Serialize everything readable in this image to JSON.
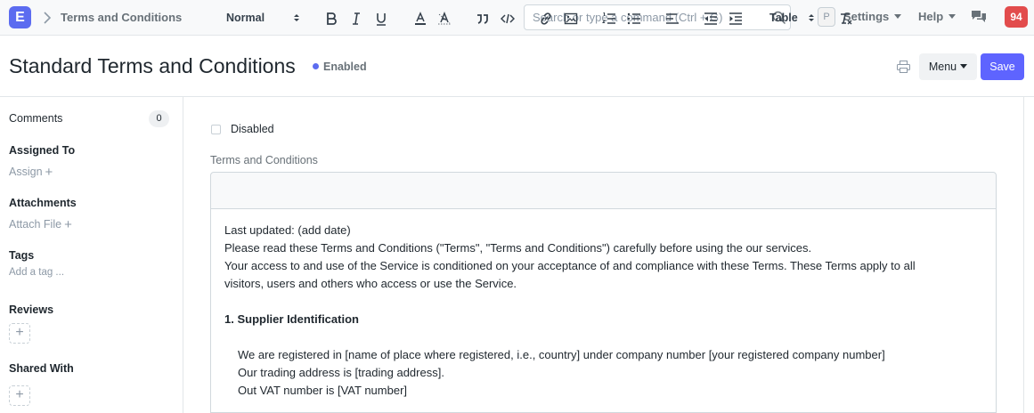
{
  "navbar": {
    "logo_letter": "E",
    "breadcrumb": "Terms and Conditions",
    "search_placeholder": "Search or type a command (Ctrl + G)",
    "user_badge": "P",
    "settings_label": "Settings",
    "help_label": "Help",
    "notification_count": "94"
  },
  "page": {
    "title": "Standard Terms and Conditions",
    "status": "Enabled",
    "menu_label": "Menu",
    "save_label": "Save"
  },
  "sidebar": {
    "comments_label": "Comments",
    "comments_count": "0",
    "assigned_to_label": "Assigned To",
    "assign_link": "Assign",
    "attachments_label": "Attachments",
    "attach_link": "Attach File",
    "tags_label": "Tags",
    "add_tag_link": "Add a tag ...",
    "reviews_label": "Reviews",
    "shared_with_label": "Shared With"
  },
  "form": {
    "disabled_label": "Disabled",
    "terms_label": "Terms and Conditions",
    "toolbar": {
      "format_select": "Normal",
      "table_select": "Table"
    },
    "editor_lines": [
      "Last updated: (add date)",
      "Please read these Terms and Conditions (\"Terms\", \"Terms and Conditions\") carefully before using the our services.",
      "Your access to and use of the Service is conditioned on your acceptance of and compliance with these Terms. These Terms apply to all",
      "visitors, users and others who access or use the Service.",
      "1. Supplier Identification",
      "We are registered in [name of place where registered, i.e., country] under company number [your registered company number]",
      "Our trading address is [trading address].",
      "Out VAT number is [VAT number]"
    ]
  },
  "colors": {
    "accent": "#5e64ff",
    "notification": "#e24c4c",
    "status_dot": "#5c6cf0"
  },
  "icons": [
    "chevron-right-icon",
    "search-icon",
    "chat-icon",
    "printer-icon",
    "bold-icon",
    "italic-icon",
    "underline-icon",
    "font-color-icon",
    "highlight-icon",
    "blockquote-icon",
    "code-icon",
    "link-icon",
    "image-icon",
    "ordered-list-icon",
    "bullet-list-icon",
    "align-left-icon",
    "outdent-icon",
    "indent-icon",
    "clear-format-icon",
    "plus-icon"
  ]
}
